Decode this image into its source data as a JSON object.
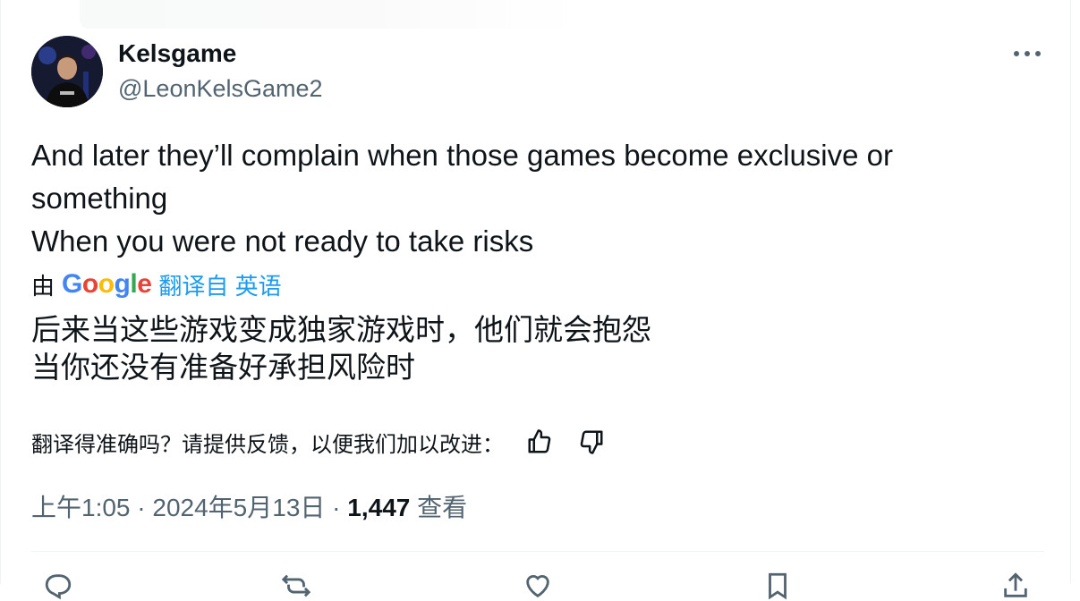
{
  "tweet": {
    "author": {
      "name": "Kelsgame",
      "handle": "@LeonKelsGame2"
    },
    "text_lines": [
      "And later they’ll complain when those games become exclusive or",
      "something",
      "When you were not ready to take risks"
    ],
    "translation": {
      "by_label": "由",
      "google_letters": [
        "G",
        "o",
        "o",
        "g",
        "l",
        "e"
      ],
      "translated_from": "翻译自 英语",
      "lines": [
        "后来当这些游戏变成独家游戏时，他们就会抱怨",
        "当你还没有准备好承担风险时"
      ],
      "feedback_prompt": "翻译得准确吗？请提供反馈，以便我们加以改进："
    },
    "meta": {
      "time": "上午1:05",
      "separator": " · ",
      "date": "2024年5月13日",
      "views_count": "1,447",
      "views_label": " 查看"
    }
  },
  "colors": {
    "text": "#0f1419",
    "secondary": "#536471",
    "link": "#1d9bf0",
    "divider": "#eff3f4"
  },
  "icons": {
    "more": "more-horizontal-icon",
    "thumbs_up": "thumbs-up-icon",
    "thumbs_down": "thumbs-down-icon",
    "reply": "reply-icon",
    "retweet": "retweet-icon",
    "like": "heart-icon",
    "bookmark": "bookmark-icon",
    "share": "share-icon"
  }
}
